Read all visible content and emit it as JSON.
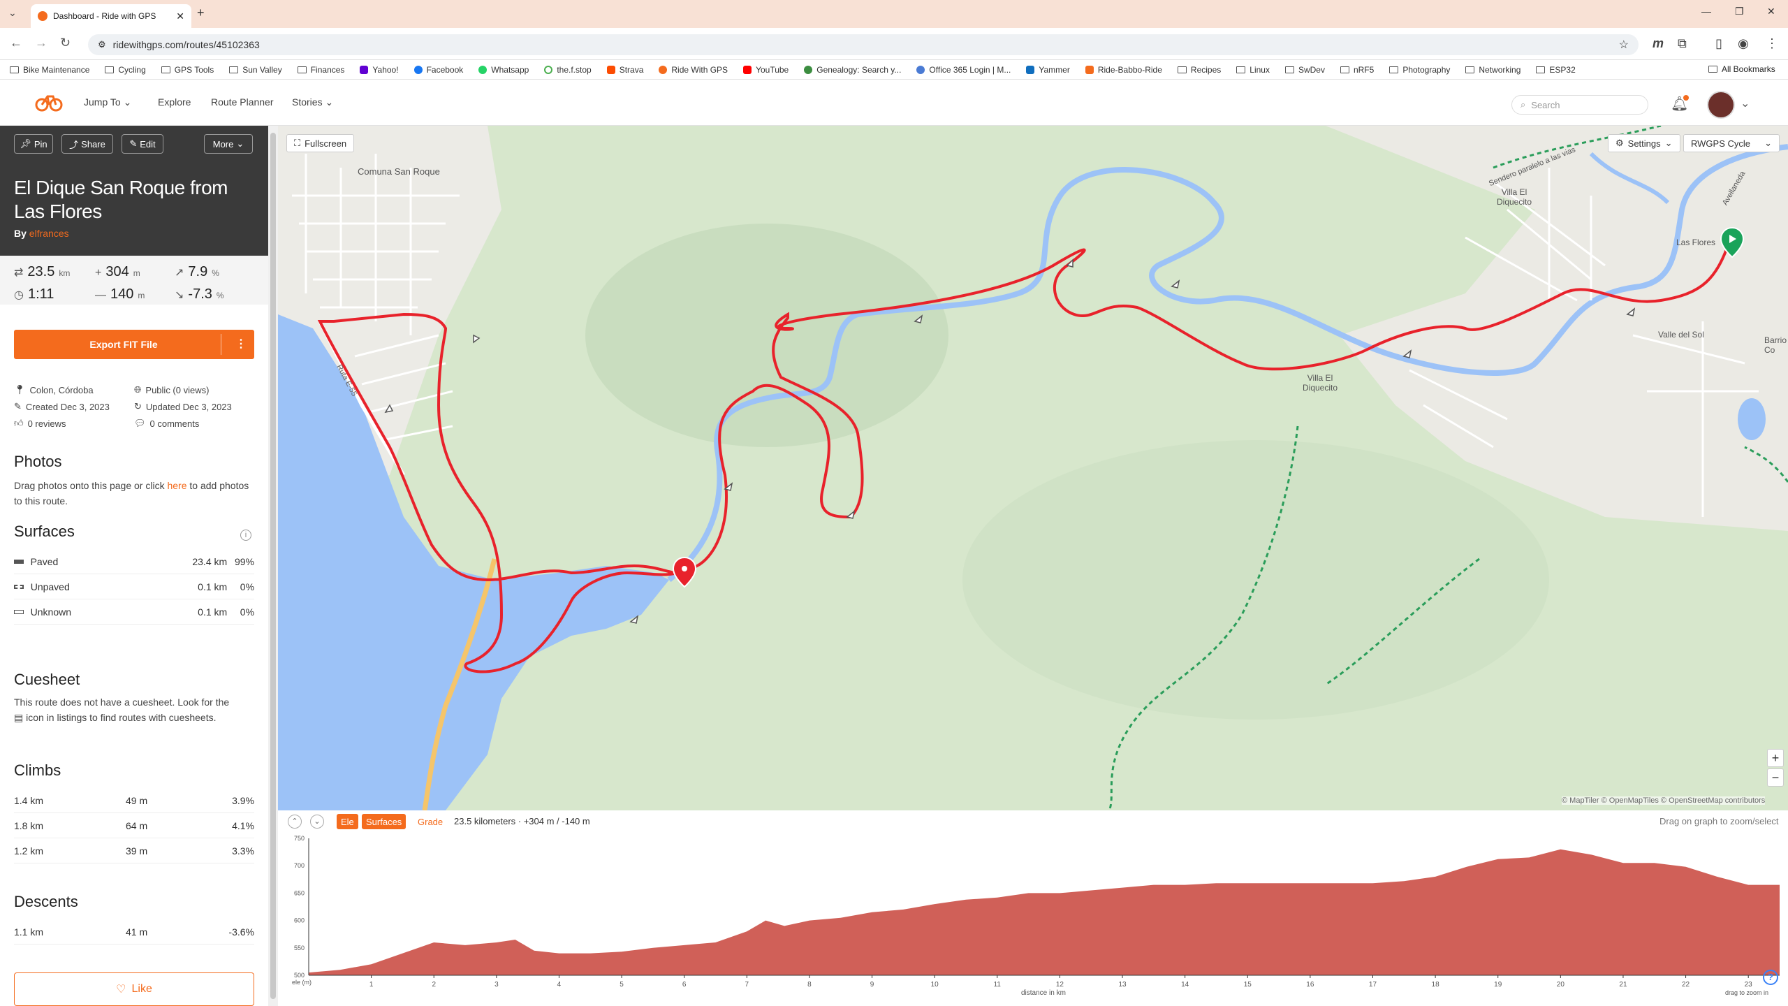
{
  "browser": {
    "tab_title": "Dashboard - Ride with GPS",
    "url": "ridewithgps.com/routes/45102363",
    "bookmarks": [
      "Bike Maintenance",
      "Cycling",
      "GPS Tools",
      "Sun Valley",
      "Finances",
      "Yahoo!",
      "Facebook",
      "Whatsapp",
      "the.f.stop",
      "Strava",
      "Ride With GPS",
      "YouTube",
      "Genealogy: Search y...",
      "Office 365 Login | M...",
      "Yammer",
      "Ride-Babbo-Ride",
      "Recipes",
      "Linux",
      "SwDev",
      "nRF5",
      "Photography",
      "Networking",
      "ESP32"
    ],
    "all_bookmarks": "All Bookmarks"
  },
  "appnav": {
    "jump_to": "Jump To",
    "explore": "Explore",
    "route_planner": "Route Planner",
    "stories": "Stories",
    "search_placeholder": "Search"
  },
  "route": {
    "pin": "Pin",
    "share": "Share",
    "edit": "Edit",
    "more": "More",
    "title": "El Dique San Roque from Las Flores",
    "by": "By",
    "author": "elfrances",
    "distance": "23.5",
    "distance_unit": "km",
    "elev_gain": "304",
    "elev_gain_unit": "m",
    "max_grade": "7.9",
    "max_grade_unit": "%",
    "duration": "1:11",
    "elev_loss": "140",
    "elev_loss_unit": "m",
    "min_grade": "-7.3",
    "min_grade_unit": "%",
    "export_label": "Export FIT File",
    "location": "Colon, Córdoba",
    "visibility": "Public (0 views)",
    "created": "Created Dec 3, 2023",
    "updated": "Updated Dec 3, 2023",
    "reviews": "0 reviews",
    "comments": "0 comments"
  },
  "photos": {
    "heading": "Photos",
    "text_before": "Drag photos onto this page or click",
    "link": "here",
    "text_after": "to add photos to this route."
  },
  "surfaces": {
    "heading": "Surfaces",
    "rows": [
      {
        "name": "Paved",
        "dist": "23.4 km",
        "pct": "99%"
      },
      {
        "name": "Unpaved",
        "dist": "0.1 km",
        "pct": "0%"
      },
      {
        "name": "Unknown",
        "dist": "0.1 km",
        "pct": "0%"
      }
    ]
  },
  "cuesheet": {
    "heading": "Cuesheet",
    "text1": "This route does not have a cuesheet. Look for the",
    "text2": "icon in listings to find routes with cuesheets."
  },
  "climbs": {
    "heading": "Climbs",
    "rows": [
      {
        "dist": "1.4 km",
        "elev": "49 m",
        "grade": "3.9%"
      },
      {
        "dist": "1.8 km",
        "elev": "64 m",
        "grade": "4.1%"
      },
      {
        "dist": "1.2 km",
        "elev": "39 m",
        "grade": "3.3%"
      }
    ]
  },
  "descents": {
    "heading": "Descents",
    "rows": [
      {
        "dist": "1.1 km",
        "elev": "41 m",
        "grade": "-3.6%"
      }
    ]
  },
  "like": "Like",
  "map": {
    "fullscreen": "Fullscreen",
    "settings": "Settings",
    "layer": "RWGPS Cycle",
    "labels": {
      "comuna": "Comuna San Roque",
      "villa_el_diquecito_n": "Villa El Diquecito",
      "las_flores": "Las Flores",
      "valle_del_sol": "Valle del Sol",
      "villa_el_diquecito_s": "Villa El Diquecito",
      "barrio": "Barrio Co",
      "ruta": "Ruta E-55",
      "sendero": "Sendero paralelo a las vias",
      "avellaneda": "Avellaneda"
    },
    "attribution": "© MapTiler © OpenMapTiles © OpenStreetMap contributors",
    "zoom_in": "+",
    "zoom_out": "−"
  },
  "elevation": {
    "ele_btn": "Ele",
    "surfaces_btn": "Surfaces",
    "grade_btn": "Grade",
    "summary": "23.5 kilometers · +304 m / -140 m",
    "hint": "Drag on graph to zoom/select",
    "y_label": "ele (m)",
    "x_label": "distance in km",
    "drag_zoom": "drag to zoom in",
    "help": "?"
  },
  "chart_data": {
    "type": "area",
    "title": "",
    "xlabel": "distance in km",
    "ylabel": "ele (m)",
    "xlim": [
      0,
      23.5
    ],
    "ylim": [
      500,
      750
    ],
    "x_ticks": [
      1,
      2,
      3,
      4,
      5,
      6,
      7,
      8,
      9,
      10,
      11,
      12,
      13,
      14,
      15,
      16,
      17,
      18,
      19,
      20,
      21,
      22,
      23
    ],
    "y_ticks": [
      500,
      550,
      600,
      650,
      700,
      750
    ],
    "colors": {
      "fill": "#d06058"
    },
    "series": [
      {
        "x": [
          0,
          0.5,
          1,
          1.5,
          2,
          2.5,
          3,
          3.3,
          3.6,
          4,
          4.5,
          5,
          5.5,
          6,
          6.5,
          7,
          7.3,
          7.6,
          8,
          8.5,
          9,
          9.5,
          10,
          10.5,
          11,
          11.5,
          12,
          12.5,
          13,
          13.5,
          14,
          14.5,
          15,
          15.5,
          16,
          16.5,
          17,
          17.5,
          18,
          18.5,
          19,
          19.5,
          20,
          20.5,
          21,
          21.5,
          22,
          22.5,
          23,
          23.5
        ],
        "y": [
          505,
          510,
          520,
          540,
          560,
          555,
          560,
          565,
          545,
          540,
          540,
          543,
          550,
          555,
          560,
          580,
          600,
          590,
          600,
          605,
          615,
          620,
          630,
          638,
          642,
          650,
          650,
          655,
          660,
          665,
          665,
          668,
          668,
          668,
          668,
          668,
          668,
          672,
          680,
          698,
          712,
          715,
          730,
          720,
          705,
          705,
          698,
          680,
          665,
          665
        ]
      }
    ]
  }
}
